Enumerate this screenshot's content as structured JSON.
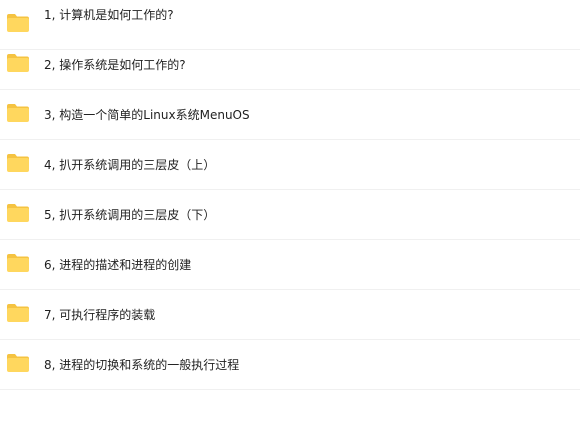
{
  "folders": [
    {
      "label": "1, 计算机是如何工作的?"
    },
    {
      "label": "2, 操作系统是如何工作的?"
    },
    {
      "label": "3, 构造一个简单的Linux系统MenuOS"
    },
    {
      "label": "4, 扒开系统调用的三层皮（上）"
    },
    {
      "label": "5, 扒开系统调用的三层皮（下）"
    },
    {
      "label": "6, 进程的描述和进程的创建"
    },
    {
      "label": "7, 可执行程序的装载"
    },
    {
      "label": "8, 进程的切换和系统的一般执行过程"
    }
  ],
  "colors": {
    "folder_body": "#ffd75e",
    "folder_back": "#f5c341",
    "divider": "#f0f0f0",
    "text": "#1f1f1f"
  },
  "icons": {
    "folder": "folder-icon"
  }
}
